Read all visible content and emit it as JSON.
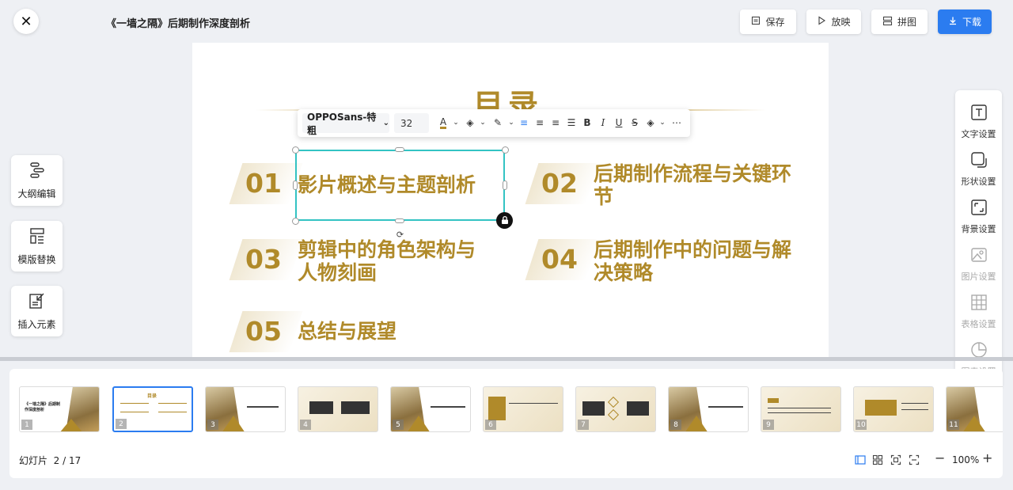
{
  "header": {
    "title": "《一墙之隔》后期制作深度剖析",
    "save_label": "保存",
    "play_label": "放映",
    "collage_label": "拼图",
    "download_label": "下载"
  },
  "left_tools": [
    {
      "label": "大纲编辑",
      "icon": "outline-icon"
    },
    {
      "label": "模版替换",
      "icon": "template-icon"
    },
    {
      "label": "插入元素",
      "icon": "insert-icon"
    }
  ],
  "right_tools": [
    {
      "label": "文字设置",
      "icon": "text-icon",
      "enabled": true
    },
    {
      "label": "形状设置",
      "icon": "shape-icon",
      "enabled": true
    },
    {
      "label": "背景设置",
      "icon": "background-icon",
      "enabled": true
    },
    {
      "label": "图片设置",
      "icon": "image-icon",
      "enabled": false
    },
    {
      "label": "表格设置",
      "icon": "table-icon",
      "enabled": false
    },
    {
      "label": "图表设置",
      "icon": "chart-icon",
      "enabled": false
    }
  ],
  "slide": {
    "title": "目录",
    "items": [
      {
        "num": "01",
        "text": "影片概述与主题剖析"
      },
      {
        "num": "02",
        "text": "后期制作流程与关键环节"
      },
      {
        "num": "03",
        "text": "剪辑中的角色架构与人物刻画"
      },
      {
        "num": "04",
        "text": "后期制作中的问题与解决策略"
      },
      {
        "num": "05",
        "text": "总结与展望"
      }
    ]
  },
  "format_toolbar": {
    "font": "OPPOSans-特粗",
    "size": "32",
    "accent": "#b08a2a"
  },
  "thumbnails": {
    "items": [
      "1",
      "2",
      "3",
      "4",
      "5",
      "6",
      "7",
      "8",
      "9",
      "10",
      "11"
    ],
    "active": "2"
  },
  "footer": {
    "slide_label": "幻灯片",
    "slide_counter": "2 / 17",
    "zoom": "100%"
  },
  "colors": {
    "primary": "#2b7cf0",
    "gold": "#b08a2a",
    "selection": "#33c3c3"
  }
}
